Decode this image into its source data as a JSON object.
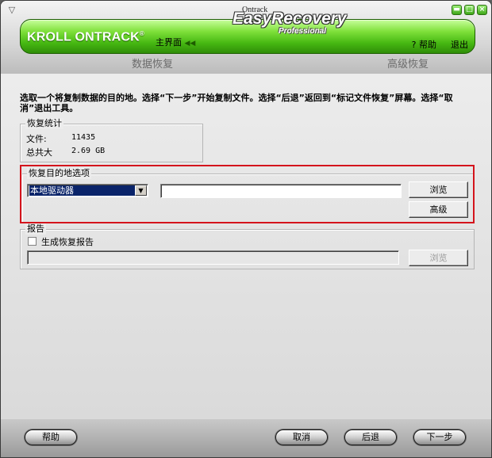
{
  "window": {
    "sys_menu_glyph": "▽",
    "buttons": {
      "minimize": "▬",
      "maximize": "□",
      "close": "×"
    }
  },
  "header": {
    "brand": "KROLL ONTRACK",
    "brand_mark": "®",
    "main_link": "主界面",
    "main_link_arrows": "◀◀",
    "help": "? 帮助",
    "exit": "退出",
    "logo": {
      "ontrack": "Ontrack",
      "product": "EasyRecovery",
      "edition": "Professional"
    },
    "tab_left": "数据恢复",
    "tab_right": "高级恢复"
  },
  "instructions": "选取一个将复制数据的目的地。选择“下一步”开始复制文件。选择“后退”返回到“标记文件恢复”屏幕。选择“取消”退出工具。",
  "stats": {
    "title": "恢复统计",
    "files_label": "文件:",
    "files_value": "11435",
    "size_label": "总共大",
    "size_value": "2.69 GB"
  },
  "destination": {
    "title": "恢复目的地选项",
    "select_value": "本地驱动器",
    "path_value": "",
    "browse": "浏览",
    "advanced": "高级"
  },
  "report": {
    "title": "报告",
    "checkbox_label": "生成恢复报告",
    "path_value": "",
    "browse": "浏览"
  },
  "footer": {
    "help": "帮助",
    "cancel": "取消",
    "back": "后退",
    "next": "下一步"
  },
  "colors": {
    "accent_green": "#46b812",
    "highlight_red": "#d4141c",
    "selection": "#0a246a"
  }
}
